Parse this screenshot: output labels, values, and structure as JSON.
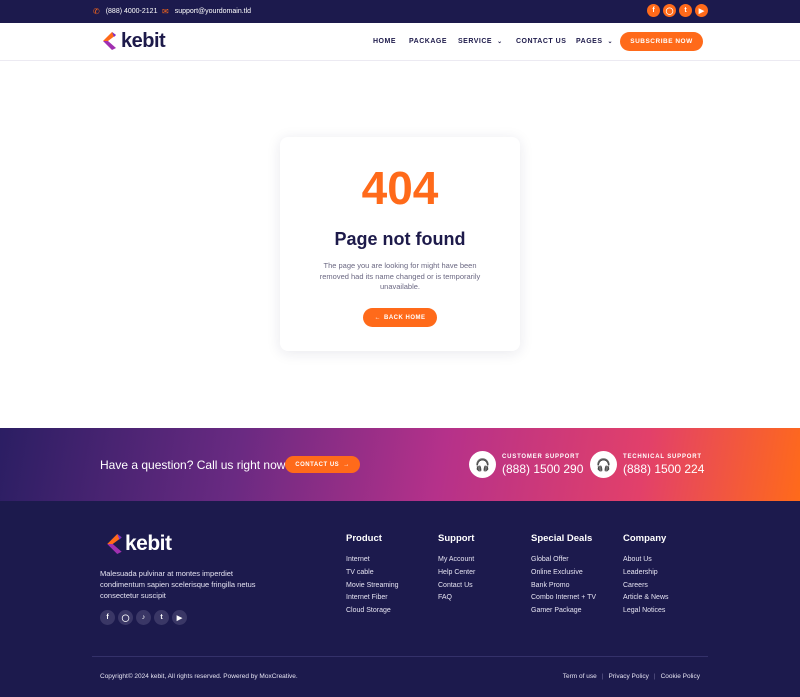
{
  "topbar": {
    "phone": "(888) 4000-2121",
    "email": "support@yourdomain.tld",
    "social_icons": [
      "facebook-icon",
      "instagram-icon",
      "twitter-icon",
      "youtube-icon"
    ]
  },
  "header": {
    "logo_text": "kebit",
    "nav": [
      {
        "label": "HOME"
      },
      {
        "label": "PACKAGE"
      },
      {
        "label": "SERVICE",
        "dropdown": true
      },
      {
        "label": "CONTACT US"
      },
      {
        "label": "PAGES",
        "dropdown": true
      }
    ],
    "subscribe_label": "SUBSCRIBE NOW"
  },
  "error": {
    "code": "404",
    "title": "Page not found",
    "description": "The page you are looking for might have been removed had its name changed or is temporarily unavailable.",
    "button_label": "BACK HOME"
  },
  "cta": {
    "question": "Have a question? Call us right now",
    "button_label": "CONTACT US",
    "customer_support": {
      "label": "CUSTOMER SUPPORT",
      "phone": "(888) 1500 290"
    },
    "technical_support": {
      "label": "TECHNICAL SUPPORT",
      "phone": "(888) 1500 224"
    }
  },
  "footer": {
    "logo_text": "kebit",
    "about": "Malesuada pulvinar at montes imperdiet condimentum sapien scelerisque fringilla netus consectetur suscipit",
    "social_icons": [
      "facebook-icon",
      "instagram-icon",
      "tiktok-icon",
      "twitter-icon",
      "youtube-icon"
    ],
    "columns": [
      {
        "heading": "Product",
        "links": [
          "Internet",
          "TV cable",
          "Movie Streaming",
          "Internet Fiber",
          "Cloud Storage"
        ]
      },
      {
        "heading": "Support",
        "links": [
          "My Account",
          "Help Center",
          "Contact Us",
          "FAQ"
        ]
      },
      {
        "heading": "Special Deals",
        "links": [
          "Global Offer",
          "Online Exclusive",
          "Bank Promo",
          "Combo Internet + TV",
          "Gamer Package"
        ]
      },
      {
        "heading": "Company",
        "links": [
          "About Us",
          "Leadership",
          "Careers",
          "Article & News",
          "Legal Notices"
        ]
      }
    ],
    "copyright": "Copyright© 2024 kebit, All rights reserved. Powered by MoxCreative.",
    "legal": [
      "Term of use",
      "Privacy Policy",
      "Cookie Policy"
    ]
  },
  "colors": {
    "accent": "#ff6a1a",
    "navy": "#1c1a4d",
    "text_dark": "#1d1a4a"
  }
}
